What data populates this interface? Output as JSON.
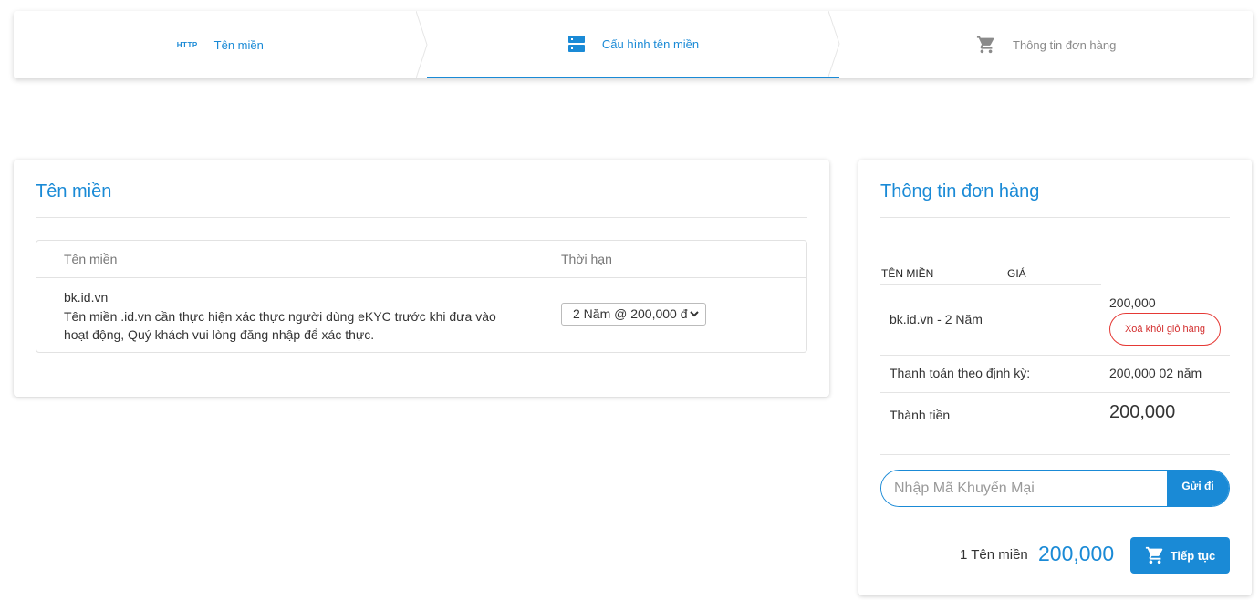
{
  "steps": [
    {
      "label": "Tên miền",
      "icon": "http-icon",
      "icon_text": "HTTP"
    },
    {
      "label": "Cấu hình tên miền",
      "icon": "server-icon"
    },
    {
      "label": "Thông tin đơn hàng",
      "icon": "cart-icon"
    }
  ],
  "domain_card": {
    "title": "Tên miền",
    "table": {
      "col_domain": "Tên miền",
      "col_term": "Thời hạn",
      "row": {
        "domain": "bk.id.vn",
        "note": "Tên miền .id.vn cần thực hiện xác thực người dùng eKYC trước khi đưa vào hoạt động, Quý khách vui lòng đăng nhập để xác thực.",
        "term_selected": "2 Năm @ 200,000 đ"
      }
    }
  },
  "order_card": {
    "title": "Thông tin đơn hàng",
    "head_domain": "TÊN MIỀN",
    "head_price": "GIÁ",
    "item_name": "bk.id.vn - 2 Năm",
    "item_price": "200,000",
    "remove_label": "Xoá khỏi giỏ hàng",
    "recurring_label": "Thanh toán theo định kỳ:",
    "recurring_value": "200,000 02 năm",
    "total_label": "Thành tiền",
    "total_value": "200,000",
    "promo_placeholder": "Nhập Mã Khuyến Mại",
    "promo_button": "Gửi đi",
    "footer_count": "1 Tên miền",
    "footer_total": "200,000",
    "continue_label": "Tiếp tục"
  },
  "colors": {
    "accent": "#1a8ad6",
    "danger": "#d32f2f",
    "muted": "#8a8a8a"
  }
}
